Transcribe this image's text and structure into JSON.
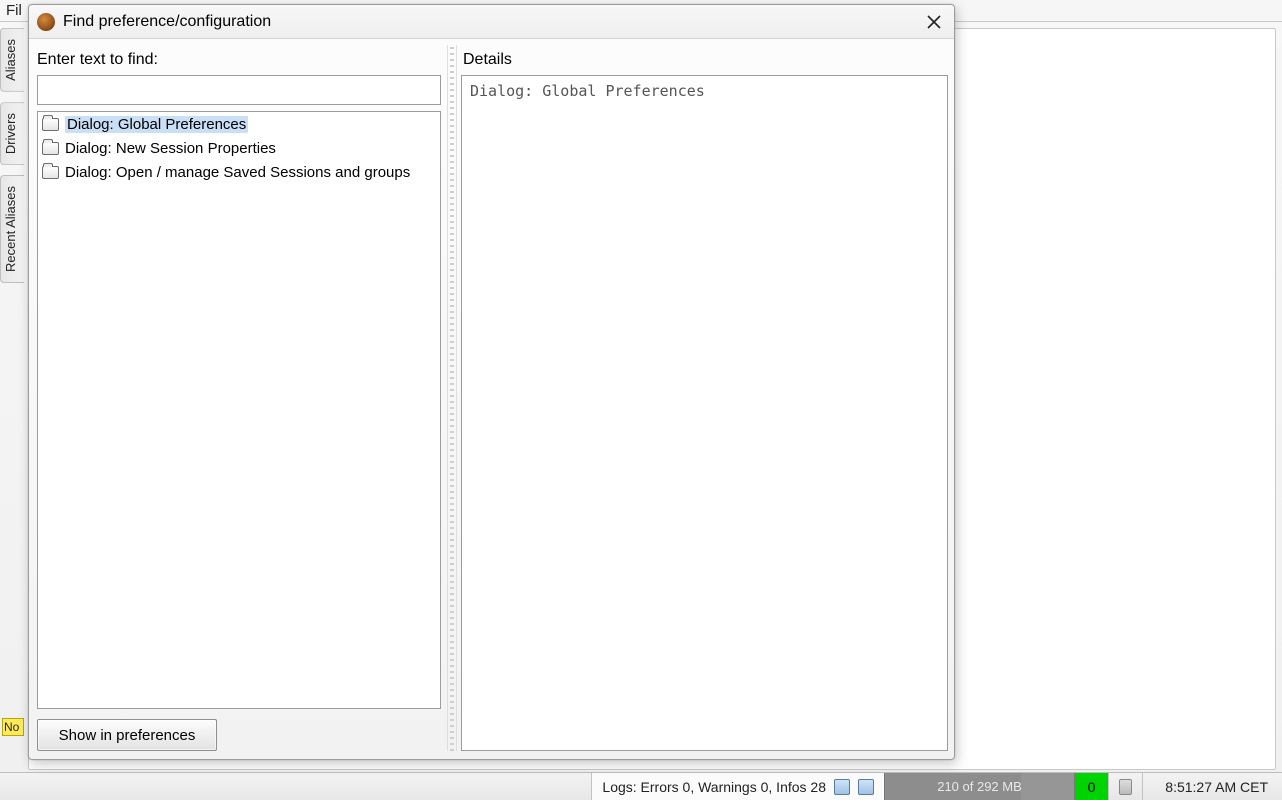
{
  "main": {
    "menubar_first": "Fil",
    "side_tabs": [
      "Aliases",
      "Drivers",
      "Recent Aliases"
    ],
    "truncated_yellow": "No"
  },
  "dialog": {
    "title": "Find preference/configuration",
    "search_label": "Enter text to find:",
    "search_value": "",
    "details_label": "Details",
    "details_text": "Dialog: Global Preferences",
    "show_button": "Show in preferences",
    "results": [
      {
        "label": "Dialog: Global Preferences",
        "selected": true
      },
      {
        "label": "Dialog: New Session Properties",
        "selected": false
      },
      {
        "label": "Dialog: Open / manage Saved Sessions and groups",
        "selected": false
      }
    ]
  },
  "status": {
    "logs": "Logs: Errors 0, Warnings 0, Infos 28",
    "memory": "210 of 292 MB",
    "green_count": "0",
    "clock": "8:51:27 AM CET"
  }
}
